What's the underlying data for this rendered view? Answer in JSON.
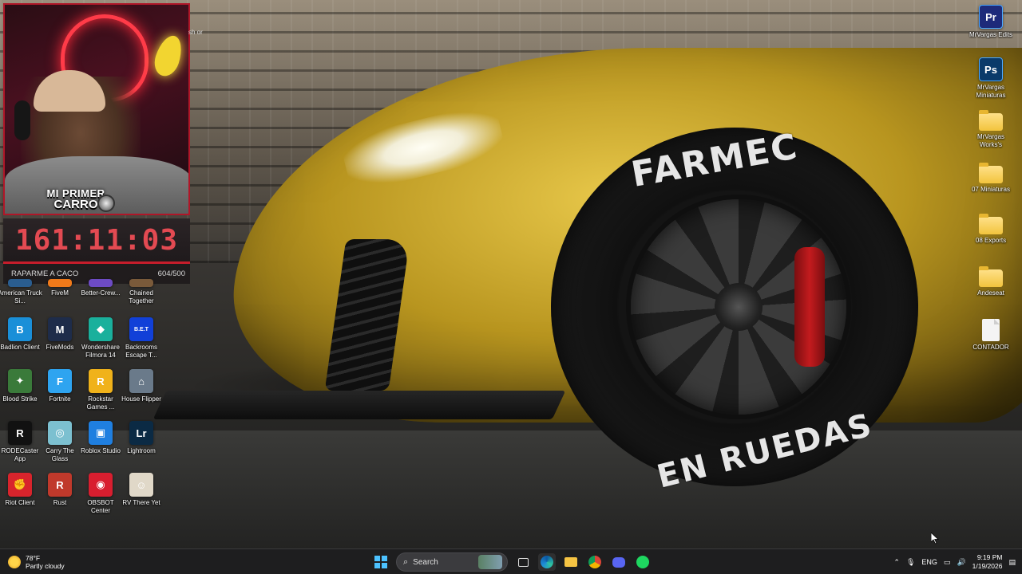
{
  "stream": {
    "badge_line1": "MI PRIMER",
    "badge_line2": "CARRO",
    "timer": "161:11:03",
    "subgoal_text": "RAPARME A CACO",
    "subgoal_progress": "604/500",
    "behind_text": "sh or"
  },
  "wallpaper": {
    "tire_brand": "FARMEC",
    "tire_text": "EN RUEDAS"
  },
  "desktop_left": [
    {
      "label": "American Truck Si...",
      "color": "#2a5d8f",
      "glyph": ""
    },
    {
      "label": "FiveM",
      "color": "#f07a1a",
      "glyph": ""
    },
    {
      "label": "Better-Crew...",
      "color": "#6d4bc4",
      "glyph": ""
    },
    {
      "label": "Chained Together",
      "color": "#7a5a3a",
      "glyph": ""
    },
    {
      "label": "Badlion Client",
      "color": "#1a8fd8",
      "glyph": "B"
    },
    {
      "label": "FiveMods",
      "color": "#1e2c4a",
      "glyph": "M"
    },
    {
      "label": "Wondershare Filmora 14",
      "color": "#1ab09c",
      "glyph": "◆"
    },
    {
      "label": "Backrooms Escape T...",
      "color": "#1140d8",
      "glyph": "B.E.T"
    },
    {
      "label": "Blood Strike",
      "color": "#3a7a3a",
      "glyph": "✦"
    },
    {
      "label": "Fortnite",
      "color": "#2ea4f0",
      "glyph": "F"
    },
    {
      "label": "Rockstar Games ...",
      "color": "#f0b21a",
      "glyph": "R"
    },
    {
      "label": "House Flipper",
      "color": "#6a7a8a",
      "glyph": "⌂"
    },
    {
      "label": "RODECaster App",
      "color": "#111111",
      "glyph": "R"
    },
    {
      "label": "Carry The Glass",
      "color": "#7cc0d0",
      "glyph": "◎"
    },
    {
      "label": "Roblox Studio",
      "color": "#1f7fe0",
      "glyph": "▣"
    },
    {
      "label": "Lightroom",
      "color": "#0b2a44",
      "glyph": "Lr"
    },
    {
      "label": "Riot Client",
      "color": "#d8242c",
      "glyph": "✊"
    },
    {
      "label": "Rust",
      "color": "#c0392b",
      "glyph": "R"
    },
    {
      "label": "OBSBOT Center",
      "color": "#d81e2f",
      "glyph": "◉"
    },
    {
      "label": "RV There Yet",
      "color": "#e0d8c8",
      "glyph": "☺"
    }
  ],
  "desktop_right": [
    {
      "label": "MrVargas Edits",
      "type": "app",
      "color": "#1d2a7a",
      "glyph": "Pr"
    },
    {
      "label": "MrVargas Miniaturas",
      "type": "app",
      "color": "#0a3a6a",
      "glyph": "Ps"
    },
    {
      "label": "MrVargas Works's",
      "type": "folder"
    },
    {
      "label": "07 Miniaturas",
      "type": "folder"
    },
    {
      "label": "08 Exports",
      "type": "folder"
    },
    {
      "label": "Andeseat",
      "type": "folder"
    },
    {
      "label": "CONTADOR",
      "type": "doc"
    }
  ],
  "taskbar": {
    "weather_temp": "78°F",
    "weather_desc": "Partly cloudy",
    "search_placeholder": "Search",
    "lang": "ENG",
    "time": "9:19 PM",
    "date": "1/19/2026"
  }
}
